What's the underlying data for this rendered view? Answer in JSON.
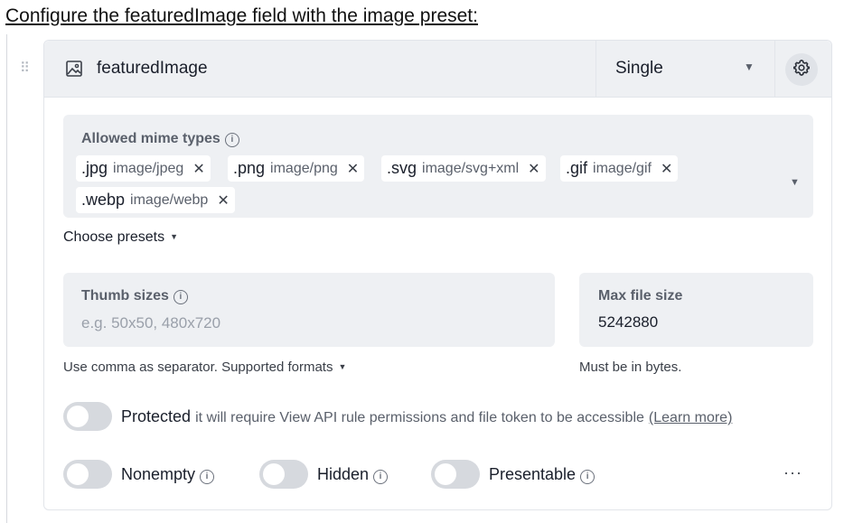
{
  "instruction": "Configure the featuredImage field with the image preset:",
  "field": {
    "name": "featuredImage",
    "icon": "image-icon",
    "type_select": "Single"
  },
  "mime": {
    "label": "Allowed mime types",
    "chips": [
      {
        "ext": ".jpg",
        "mime": "image/jpeg"
      },
      {
        "ext": ".png",
        "mime": "image/png"
      },
      {
        "ext": ".svg",
        "mime": "image/svg+xml"
      },
      {
        "ext": ".gif",
        "mime": "image/gif"
      },
      {
        "ext": ".webp",
        "mime": "image/webp"
      }
    ],
    "presets_label": "Choose presets"
  },
  "thumb": {
    "label": "Thumb sizes",
    "placeholder": "e.g. 50x50, 480x720",
    "value": "",
    "help": "Use comma as separator. Supported formats"
  },
  "maxsize": {
    "label": "Max file size",
    "value": "5242880",
    "help": "Must be in bytes."
  },
  "protected": {
    "label": "Protected",
    "desc": "it will require View API rule permissions and file token to be accessible",
    "link": "(Learn more)",
    "on": false
  },
  "options": [
    {
      "label": "Nonempty",
      "on": false
    },
    {
      "label": "Hidden",
      "on": false
    },
    {
      "label": "Presentable",
      "on": false
    }
  ],
  "more": "···",
  "colors": {
    "panel": "#eef0f3",
    "toggle_off": "#d6d9de",
    "text": "#1a1f2b",
    "muted": "#5a606b"
  }
}
